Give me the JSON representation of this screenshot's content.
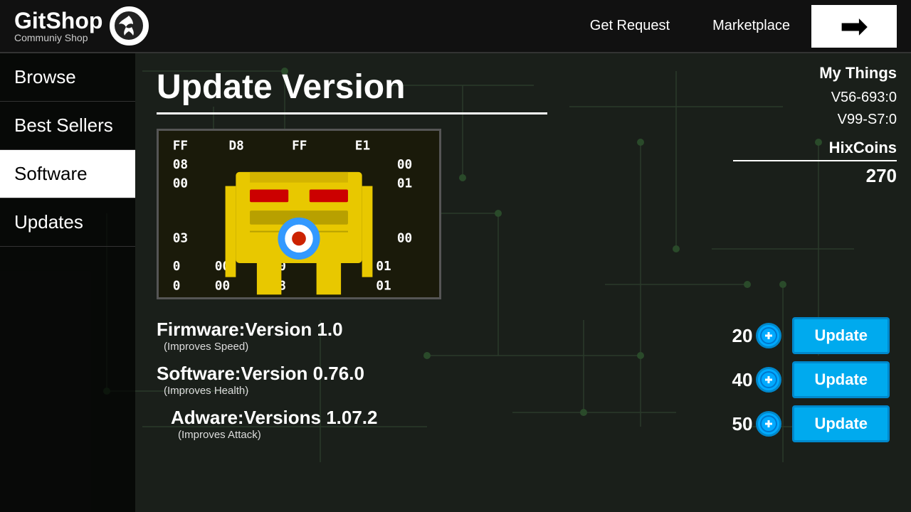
{
  "header": {
    "logo_title": "GitShop",
    "logo_subtitle": "Communiy Shop",
    "nav": {
      "get_request": "Get Request",
      "marketplace": "Marketplace"
    },
    "arrow_label": "→"
  },
  "sidebar": {
    "items": [
      {
        "label": "Browse",
        "active": false
      },
      {
        "label": "Best Sellers",
        "active": false
      },
      {
        "label": "Software",
        "active": true
      },
      {
        "label": "Updates",
        "active": false
      }
    ]
  },
  "main": {
    "page_title": "Update Version",
    "updates": [
      {
        "name": "Firmware:Version 1.0",
        "desc": "(Improves Speed)",
        "price": "20",
        "btn_label": "Update"
      },
      {
        "name": "Software:Version 0.76.0",
        "desc": "(Improves Health)",
        "price": "40",
        "btn_label": "Update"
      },
      {
        "name": "Adware:Versions 1.07.2",
        "desc": "(Improves Attack)",
        "price": "50",
        "btn_label": "Update"
      }
    ],
    "robot": {
      "hex_rows": [
        [
          "FF",
          "D8",
          "FF",
          "E1"
        ],
        [
          "08",
          "",
          "",
          "00"
        ],
        [
          "00",
          "",
          "",
          "01"
        ],
        [
          "03",
          "",
          "",
          "00"
        ],
        [
          "0",
          "00",
          "A0",
          "01"
        ],
        [
          "0",
          "00",
          "28",
          "01"
        ]
      ]
    }
  },
  "right_panel": {
    "my_things_label": "My Things",
    "v1_label": "V56-693:",
    "v1_value": "0",
    "v2_label": "V99-S7:",
    "v2_value": "0",
    "hixcoins_label": "HixCoins",
    "hixcoins_value": "270"
  }
}
